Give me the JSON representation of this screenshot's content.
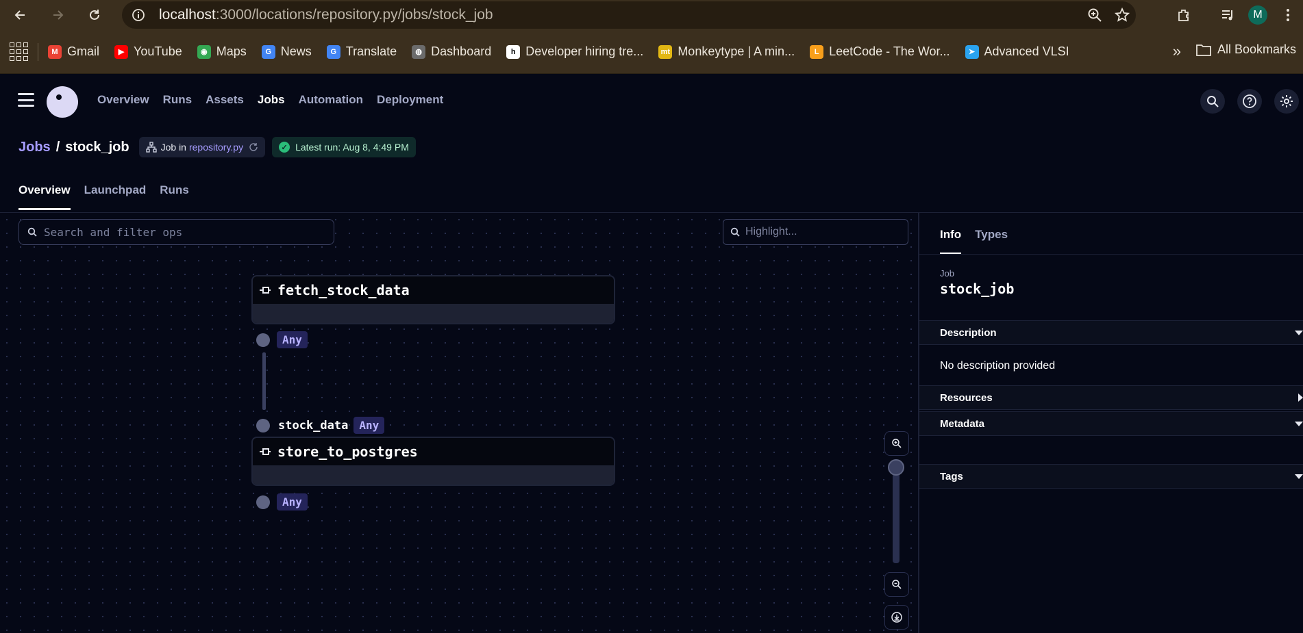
{
  "browser": {
    "url_host": "localhost",
    "url_path": ":3000/locations/repository.py/jobs/stock_job",
    "profile_initial": "M",
    "bookmarks": [
      {
        "label": "Gmail",
        "color": "#ea4335",
        "glyph": "M"
      },
      {
        "label": "YouTube",
        "color": "#ff0000",
        "glyph": "▶"
      },
      {
        "label": "Maps",
        "color": "#34a853",
        "glyph": "◉"
      },
      {
        "label": "News",
        "color": "#4285f4",
        "glyph": "G"
      },
      {
        "label": "Translate",
        "color": "#4285f4",
        "glyph": "G"
      },
      {
        "label": "Dashboard",
        "color": "#6b6b6b",
        "glyph": "◍"
      },
      {
        "label": "Developer hiring tre...",
        "color": "#ffffff",
        "glyph": "h"
      },
      {
        "label": "Monkeytype | A min...",
        "color": "#e2b714",
        "glyph": "mt"
      },
      {
        "label": "LeetCode - The Wor...",
        "color": "#f89f1b",
        "glyph": "L"
      },
      {
        "label": "Advanced VLSI",
        "color": "#2aa3ef",
        "glyph": "➤"
      }
    ],
    "all_bookmarks_label": "All Bookmarks"
  },
  "app": {
    "nav": [
      {
        "label": "Overview",
        "active": false
      },
      {
        "label": "Runs",
        "active": false
      },
      {
        "label": "Assets",
        "active": false
      },
      {
        "label": "Jobs",
        "active": true
      },
      {
        "label": "Automation",
        "active": false
      },
      {
        "label": "Deployment",
        "active": false
      }
    ],
    "icons": [
      "search-icon",
      "help-icon",
      "gear-icon"
    ]
  },
  "page": {
    "crumb_jobs": "Jobs",
    "crumb_sep": "/",
    "crumb_current": "stock_job",
    "job_chip_prefix": "Job in",
    "job_chip_repo": "repository.py",
    "latest_run": "Latest run: Aug 8, 4:49 PM",
    "tabs": [
      {
        "label": "Overview",
        "active": true
      },
      {
        "label": "Launchpad",
        "active": false
      },
      {
        "label": "Runs",
        "active": false
      }
    ]
  },
  "graph": {
    "search_placeholder": "Search and filter ops",
    "highlight_placeholder": "Highlight...",
    "ops": [
      {
        "name": "fetch_stock_data",
        "output_type": "Any"
      },
      {
        "name": "store_to_postgres",
        "input_name": "stock_data",
        "input_type": "Any",
        "output_type": "Any"
      }
    ]
  },
  "panel": {
    "tabs": [
      {
        "label": "Info",
        "active": true
      },
      {
        "label": "Types",
        "active": false
      }
    ],
    "job_label": "Job",
    "job_name": "stock_job",
    "sections": {
      "description": "Description",
      "description_text": "No description provided",
      "resources": "Resources",
      "metadata": "Metadata",
      "tags": "Tags"
    }
  }
}
